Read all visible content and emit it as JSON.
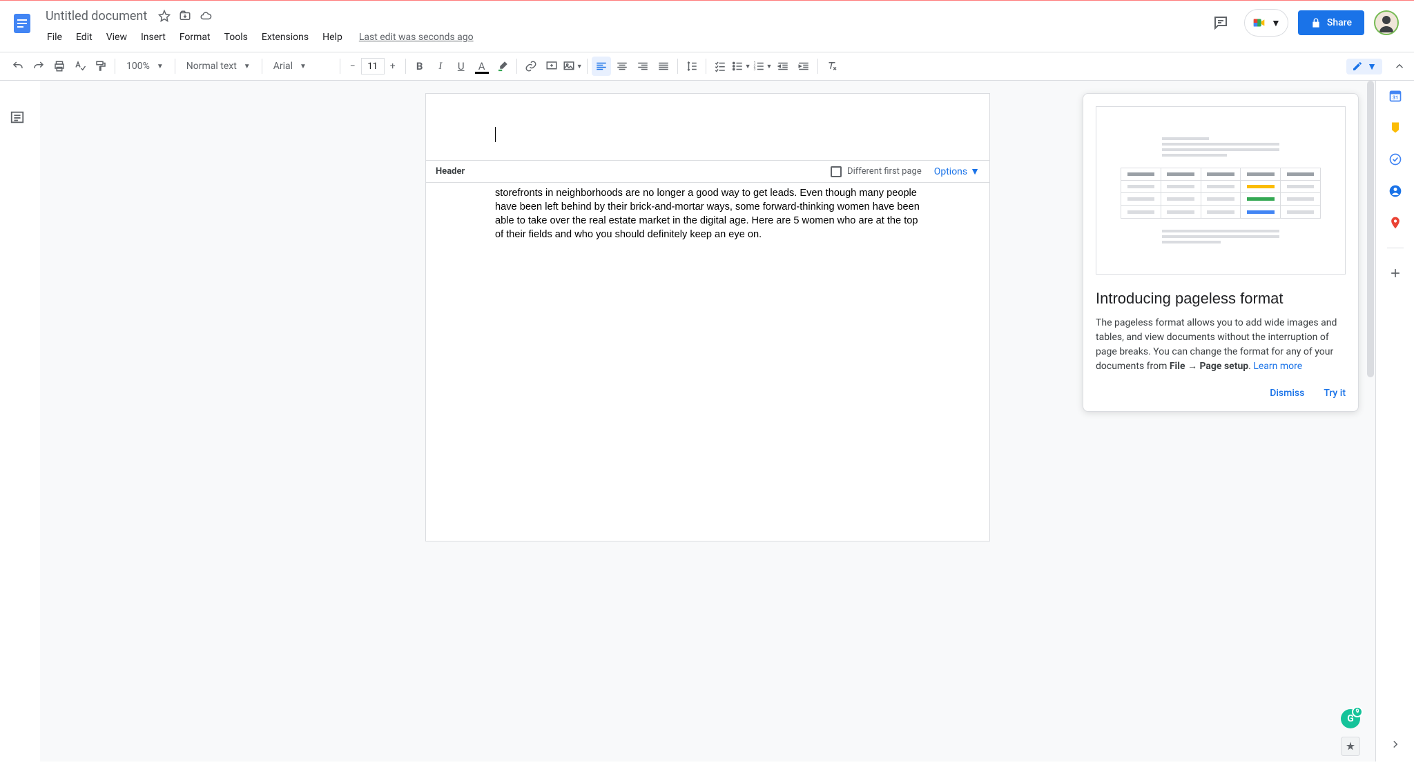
{
  "doc": {
    "title": "Untitled document",
    "last_edit": "Last edit was seconds ago"
  },
  "menu": [
    "File",
    "Edit",
    "View",
    "Insert",
    "Format",
    "Tools",
    "Extensions",
    "Help"
  ],
  "share_label": "Share",
  "toolbar": {
    "zoom": "100%",
    "style": "Normal text",
    "font": "Arial",
    "size": "11"
  },
  "header_section": {
    "label": "Header",
    "different_first": "Different first page",
    "options": "Options"
  },
  "body_text": "storefronts in neighborhoods are no longer a good way to get leads. Even though many people have been left behind by their brick-and-mortar ways, some forward-thinking women have been able to take over the real estate market in the digital age. Here are 5 women who are at the top of their fields and who you should definitely keep an eye on.",
  "popup": {
    "title": "Introducing pageless format",
    "body_pre": "The pageless format allows you to add wide images and tables, and view documents without the interruption of page breaks. You can change the format for any of your documents from ",
    "body_bold": "File → Page setup",
    "body_post": ". ",
    "learn_more": "Learn more",
    "dismiss": "Dismiss",
    "try_it": "Try it"
  },
  "grammarly_count": "9"
}
